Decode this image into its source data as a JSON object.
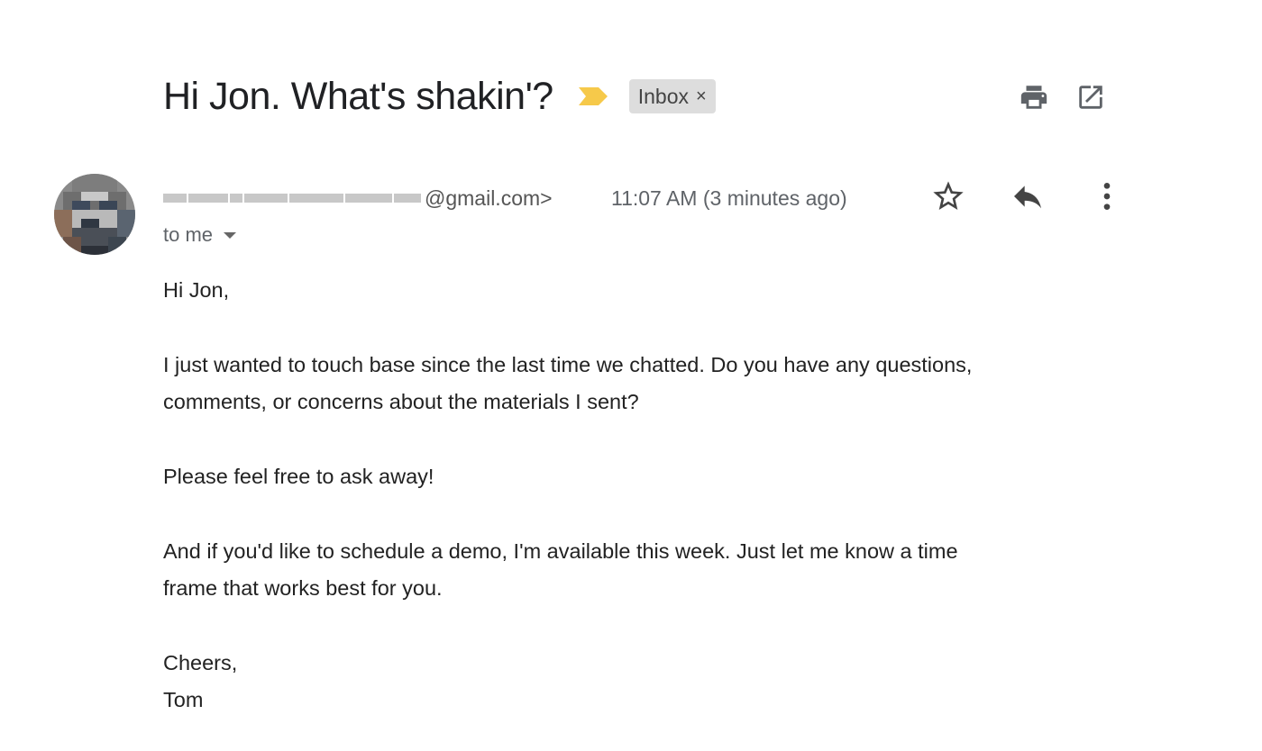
{
  "subject": "Hi Jon. What's shakin'?",
  "label": {
    "name": "Inbox",
    "remove": "×"
  },
  "toolbar": {
    "print_icon": "print-icon",
    "open_new_window_icon": "open-in-new-window-icon"
  },
  "message": {
    "sender_domain": "@gmail.com>",
    "timestamp": "11:07 AM (3 minutes ago)",
    "recipient": "to me",
    "actions": {
      "star_icon": "star-icon",
      "reply_icon": "reply-icon",
      "more_icon": "more-vert-icon"
    },
    "greeting": "Hi Jon,",
    "paragraph1_line1": "I just wanted to touch base since the last time we chatted. Do you have any questions,",
    "paragraph1_line2": "comments, or concerns about the materials I sent?",
    "paragraph2": "Please feel free to ask away!",
    "paragraph3_line1": "And if you'd like to schedule a demo, I'm available this week. Just let me know a time",
    "paragraph3_line2": "frame that works best for you.",
    "signoff": "Cheers,",
    "signature": "Tom"
  },
  "colors": {
    "importance": "#f6c94a",
    "chip_bg": "#dddddd",
    "icon": "#5f6368"
  }
}
